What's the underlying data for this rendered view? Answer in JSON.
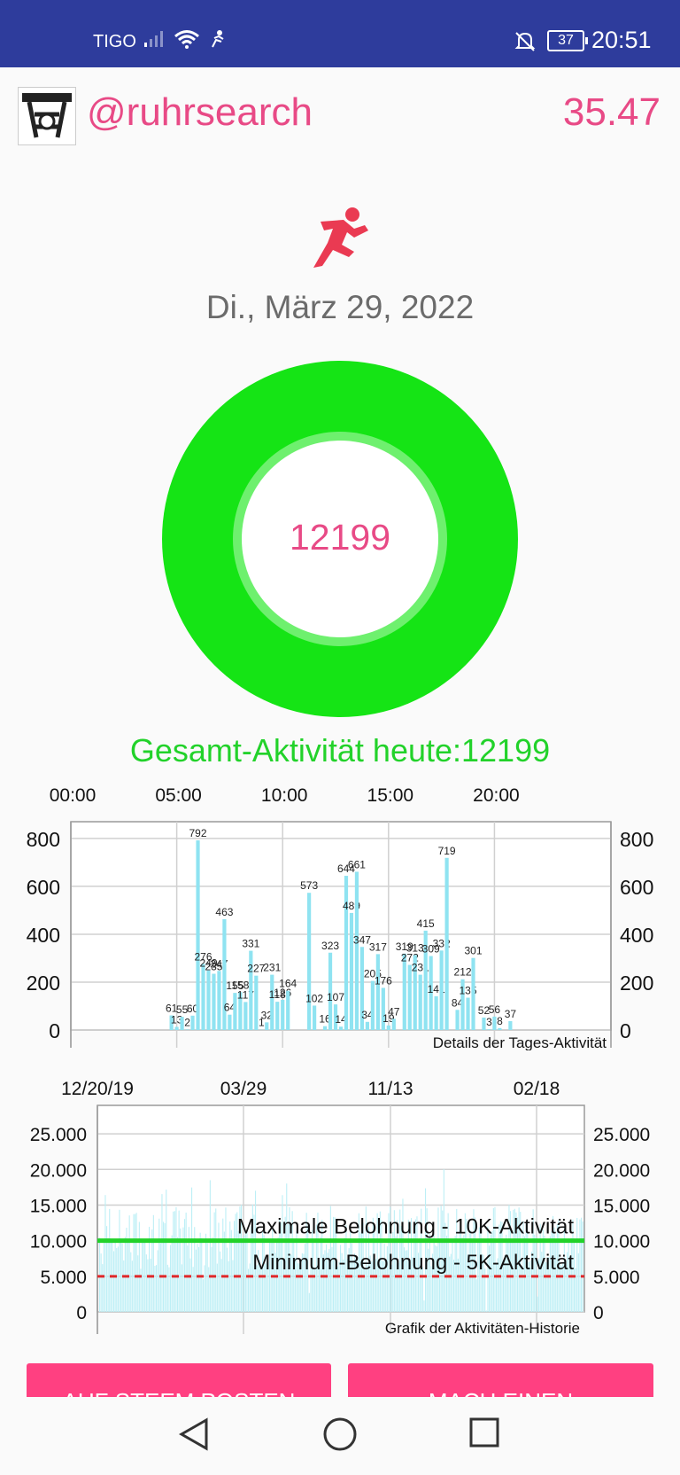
{
  "status": {
    "carrier": "TIGO",
    "battery": "37",
    "time": "20:51"
  },
  "header": {
    "username": "@ruhrsearch",
    "score": "35.47"
  },
  "date": "Di., März 29, 2022",
  "ring_value": "12199",
  "ring_progress": 1.0,
  "total_label": "Gesamt-Aktivität heute:12199",
  "buttons": {
    "post": "AUF STEEM POSTEN",
    "other": "MACH EINEN"
  },
  "colors": {
    "statusbar": "#2e3c9c",
    "accent": "#e84a86",
    "ring": "#15e415",
    "bar": "#8fe3f1",
    "total": "#22d22a"
  },
  "chart_data": [
    {
      "type": "bar",
      "title": "Details der Tages-Aktivität",
      "x_ticks": [
        "00:00",
        "05:00",
        "10:00",
        "15:00",
        "20:00"
      ],
      "y_ticks": [
        "0",
        "200",
        "400",
        "600",
        "800"
      ],
      "ylim": [
        0,
        870
      ],
      "grid": true,
      "points": [
        [
          4.75,
          61
        ],
        [
          5.0,
          13
        ],
        [
          5.25,
          55
        ],
        [
          5.5,
          2
        ],
        [
          5.75,
          60
        ],
        [
          6.0,
          792
        ],
        [
          6.25,
          276
        ],
        [
          6.5,
          249
        ],
        [
          6.75,
          235
        ],
        [
          7.0,
          247
        ],
        [
          7.25,
          463
        ],
        [
          7.5,
          64
        ],
        [
          7.75,
          155
        ],
        [
          8.0,
          158
        ],
        [
          8.25,
          117
        ],
        [
          8.5,
          331
        ],
        [
          8.75,
          227
        ],
        [
          9.0,
          1
        ],
        [
          9.25,
          32
        ],
        [
          9.5,
          231
        ],
        [
          9.75,
          118
        ],
        [
          10.0,
          126
        ],
        [
          10.25,
          164
        ],
        [
          11.25,
          573
        ],
        [
          11.5,
          102
        ],
        [
          12.0,
          16
        ],
        [
          12.25,
          323
        ],
        [
          12.5,
          107
        ],
        [
          12.75,
          14
        ],
        [
          13.0,
          644
        ],
        [
          13.25,
          489
        ],
        [
          13.5,
          661
        ],
        [
          13.75,
          347
        ],
        [
          14.0,
          34
        ],
        [
          14.25,
          205
        ],
        [
          14.5,
          317
        ],
        [
          14.75,
          176
        ],
        [
          15.0,
          19
        ],
        [
          15.25,
          47
        ],
        [
          15.75,
          319
        ],
        [
          16.0,
          272
        ],
        [
          16.25,
          313
        ],
        [
          16.5,
          231
        ],
        [
          16.75,
          415
        ],
        [
          17.0,
          309
        ],
        [
          17.25,
          141
        ],
        [
          17.5,
          332
        ],
        [
          17.75,
          719
        ],
        [
          18.25,
          84
        ],
        [
          18.5,
          212
        ],
        [
          18.75,
          135
        ],
        [
          19.0,
          301
        ],
        [
          19.5,
          52
        ],
        [
          19.75,
          3
        ],
        [
          20.0,
          56
        ],
        [
          20.25,
          8
        ],
        [
          20.75,
          37
        ]
      ]
    },
    {
      "type": "bar",
      "title": "Grafik der Aktivitäten-Historie",
      "x_ticks": [
        "12/20/19",
        "03/29",
        "11/13",
        "02/18"
      ],
      "y_ticks": [
        "0",
        "5.000",
        "10.000",
        "15.000",
        "20.000",
        "25.000"
      ],
      "ylim": [
        0,
        29000
      ],
      "grid": true,
      "reference_lines": [
        {
          "label": "Maximale Belohnung - 10K-Aktivität",
          "value": 10000,
          "color": "#22d22a",
          "style": "solid"
        },
        {
          "label": "Minimum-Belohnung - 5K-Aktivität",
          "value": 5000,
          "color": "#e0282a",
          "style": "dashed"
        }
      ]
    }
  ]
}
